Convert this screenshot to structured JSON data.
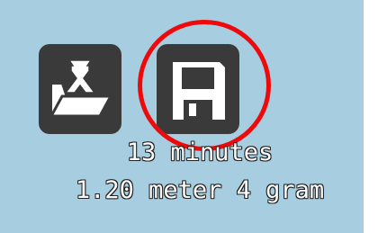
{
  "toolbar": {
    "open_icon": "open-folder-icon",
    "save_icon": "save-floppy-icon"
  },
  "colors": {
    "panel_background": "#a7cee0",
    "button_background": "#3a3a3a",
    "highlight": "#ee0a0a",
    "text": "#ffffff"
  },
  "print_info": {
    "time": "13 minutes",
    "length_weight": "1.20 meter 4 gram"
  }
}
